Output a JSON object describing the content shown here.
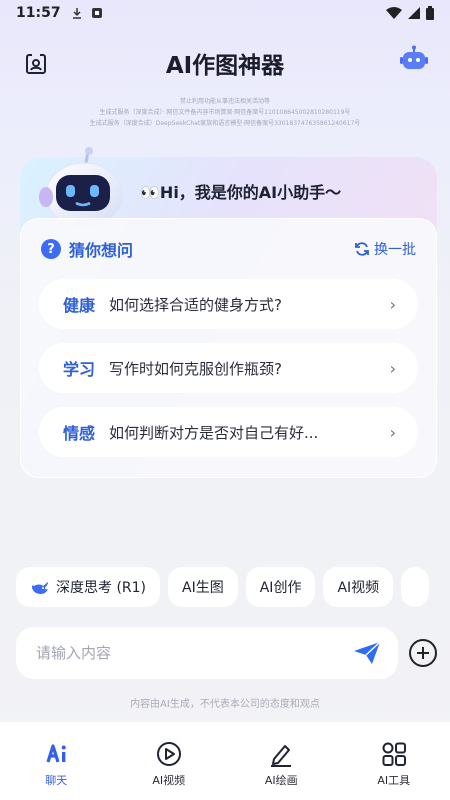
{
  "status_bar": {
    "time": "11:57"
  },
  "header": {
    "title": "AI作图神器"
  },
  "disclaimer": {
    "lines": [
      "禁止利用功能从事违法相关活动等",
      "生成式服务（深度合成）· 网信文件备内容市场算案·网信备案号110108645002810280119号",
      "生成式服务（深度合成）DeepSeekChat家族和语言模型·网信备案号330183747635861240617号"
    ]
  },
  "hero": {
    "greeting": "👀Hi，我是你的AI小助手～"
  },
  "guess": {
    "title": "猜你想问",
    "refresh_label": "换一批",
    "items": [
      {
        "category": "健康",
        "question": "如何选择合适的健身方式?"
      },
      {
        "category": "学习",
        "question": "写作时如何克服创作瓶颈?"
      },
      {
        "category": "情感",
        "question": "如何判断对方是否对自己有好..."
      }
    ]
  },
  "chips": [
    "深度思考 (R1)",
    "AI生图",
    "AI创作",
    "AI视频"
  ],
  "input": {
    "placeholder": "请输入内容"
  },
  "footnote": "内容由AI生成，不代表本公司的态度和观点",
  "tabs": [
    {
      "label": "聊天",
      "icon": "ai-chat-icon",
      "active": true
    },
    {
      "label": "AI视频",
      "icon": "play-circle-icon",
      "active": false
    },
    {
      "label": "AI绘画",
      "icon": "pen-icon",
      "active": false
    },
    {
      "label": "AI工具",
      "icon": "grid-icon",
      "active": false
    }
  ],
  "colors": {
    "accent": "#3361e6",
    "brand_blue": "#2f5fd9"
  }
}
